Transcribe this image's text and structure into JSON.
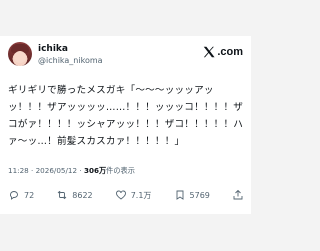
{
  "user": {
    "name": "ichika",
    "handle": "@ichika_nikoma"
  },
  "brand": {
    "logo_text": ".com"
  },
  "tweet": {
    "text": "ギリギリで勝ったメスガキ「～～～ッッッアッッ！！！ザアッッッッ……！！！ッッッコ！！！！ザコがァ！！！！ッシャアッッ！！！ザコ！！！！！ハァ～ッ…！前髪スカスカァ！！！！！」",
    "time": "11:28",
    "date": "2026/05/12",
    "views_count": "306万",
    "views_label": "件の表示",
    "dot": "·"
  },
  "actions": {
    "replies": "72",
    "retweets": "8622",
    "likes": "7.1万",
    "bookmarks": "5769"
  }
}
